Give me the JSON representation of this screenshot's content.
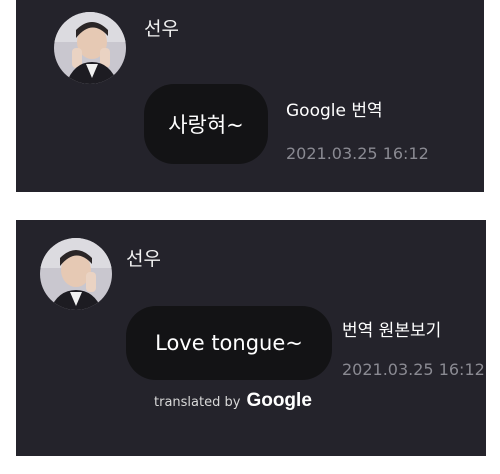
{
  "message1": {
    "sender": "선우",
    "text": "사랑혀~",
    "action": "Google 번역",
    "timestamp": "2021.03.25 16:12"
  },
  "message2": {
    "sender": "선우",
    "text": "Love tongue~",
    "action": "번역 원본보기",
    "timestamp": "2021.03.25 16:12",
    "credit_prefix": "translated by",
    "credit_brand": "Google"
  }
}
